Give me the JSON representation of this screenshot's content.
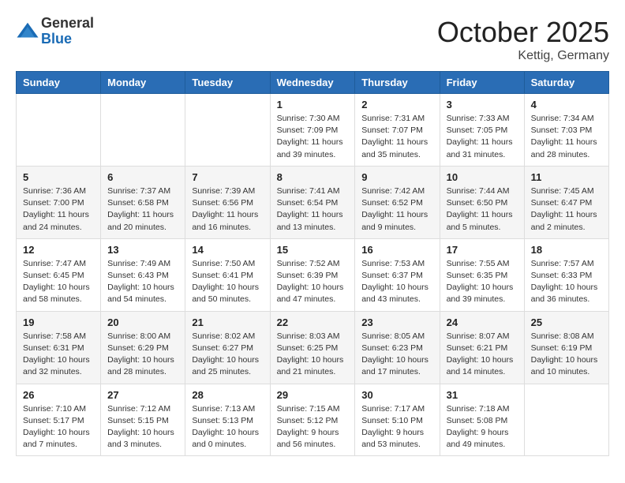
{
  "header": {
    "logo_line1": "General",
    "logo_line2": "Blue",
    "month": "October 2025",
    "location": "Kettig, Germany"
  },
  "weekdays": [
    "Sunday",
    "Monday",
    "Tuesday",
    "Wednesday",
    "Thursday",
    "Friday",
    "Saturday"
  ],
  "weeks": [
    [
      {
        "day": "",
        "info": ""
      },
      {
        "day": "",
        "info": ""
      },
      {
        "day": "",
        "info": ""
      },
      {
        "day": "1",
        "info": "Sunrise: 7:30 AM\nSunset: 7:09 PM\nDaylight: 11 hours\nand 39 minutes."
      },
      {
        "day": "2",
        "info": "Sunrise: 7:31 AM\nSunset: 7:07 PM\nDaylight: 11 hours\nand 35 minutes."
      },
      {
        "day": "3",
        "info": "Sunrise: 7:33 AM\nSunset: 7:05 PM\nDaylight: 11 hours\nand 31 minutes."
      },
      {
        "day": "4",
        "info": "Sunrise: 7:34 AM\nSunset: 7:03 PM\nDaylight: 11 hours\nand 28 minutes."
      }
    ],
    [
      {
        "day": "5",
        "info": "Sunrise: 7:36 AM\nSunset: 7:00 PM\nDaylight: 11 hours\nand 24 minutes."
      },
      {
        "day": "6",
        "info": "Sunrise: 7:37 AM\nSunset: 6:58 PM\nDaylight: 11 hours\nand 20 minutes."
      },
      {
        "day": "7",
        "info": "Sunrise: 7:39 AM\nSunset: 6:56 PM\nDaylight: 11 hours\nand 16 minutes."
      },
      {
        "day": "8",
        "info": "Sunrise: 7:41 AM\nSunset: 6:54 PM\nDaylight: 11 hours\nand 13 minutes."
      },
      {
        "day": "9",
        "info": "Sunrise: 7:42 AM\nSunset: 6:52 PM\nDaylight: 11 hours\nand 9 minutes."
      },
      {
        "day": "10",
        "info": "Sunrise: 7:44 AM\nSunset: 6:50 PM\nDaylight: 11 hours\nand 5 minutes."
      },
      {
        "day": "11",
        "info": "Sunrise: 7:45 AM\nSunset: 6:47 PM\nDaylight: 11 hours\nand 2 minutes."
      }
    ],
    [
      {
        "day": "12",
        "info": "Sunrise: 7:47 AM\nSunset: 6:45 PM\nDaylight: 10 hours\nand 58 minutes."
      },
      {
        "day": "13",
        "info": "Sunrise: 7:49 AM\nSunset: 6:43 PM\nDaylight: 10 hours\nand 54 minutes."
      },
      {
        "day": "14",
        "info": "Sunrise: 7:50 AM\nSunset: 6:41 PM\nDaylight: 10 hours\nand 50 minutes."
      },
      {
        "day": "15",
        "info": "Sunrise: 7:52 AM\nSunset: 6:39 PM\nDaylight: 10 hours\nand 47 minutes."
      },
      {
        "day": "16",
        "info": "Sunrise: 7:53 AM\nSunset: 6:37 PM\nDaylight: 10 hours\nand 43 minutes."
      },
      {
        "day": "17",
        "info": "Sunrise: 7:55 AM\nSunset: 6:35 PM\nDaylight: 10 hours\nand 39 minutes."
      },
      {
        "day": "18",
        "info": "Sunrise: 7:57 AM\nSunset: 6:33 PM\nDaylight: 10 hours\nand 36 minutes."
      }
    ],
    [
      {
        "day": "19",
        "info": "Sunrise: 7:58 AM\nSunset: 6:31 PM\nDaylight: 10 hours\nand 32 minutes."
      },
      {
        "day": "20",
        "info": "Sunrise: 8:00 AM\nSunset: 6:29 PM\nDaylight: 10 hours\nand 28 minutes."
      },
      {
        "day": "21",
        "info": "Sunrise: 8:02 AM\nSunset: 6:27 PM\nDaylight: 10 hours\nand 25 minutes."
      },
      {
        "day": "22",
        "info": "Sunrise: 8:03 AM\nSunset: 6:25 PM\nDaylight: 10 hours\nand 21 minutes."
      },
      {
        "day": "23",
        "info": "Sunrise: 8:05 AM\nSunset: 6:23 PM\nDaylight: 10 hours\nand 17 minutes."
      },
      {
        "day": "24",
        "info": "Sunrise: 8:07 AM\nSunset: 6:21 PM\nDaylight: 10 hours\nand 14 minutes."
      },
      {
        "day": "25",
        "info": "Sunrise: 8:08 AM\nSunset: 6:19 PM\nDaylight: 10 hours\nand 10 minutes."
      }
    ],
    [
      {
        "day": "26",
        "info": "Sunrise: 7:10 AM\nSunset: 5:17 PM\nDaylight: 10 hours\nand 7 minutes."
      },
      {
        "day": "27",
        "info": "Sunrise: 7:12 AM\nSunset: 5:15 PM\nDaylight: 10 hours\nand 3 minutes."
      },
      {
        "day": "28",
        "info": "Sunrise: 7:13 AM\nSunset: 5:13 PM\nDaylight: 10 hours\nand 0 minutes."
      },
      {
        "day": "29",
        "info": "Sunrise: 7:15 AM\nSunset: 5:12 PM\nDaylight: 9 hours\nand 56 minutes."
      },
      {
        "day": "30",
        "info": "Sunrise: 7:17 AM\nSunset: 5:10 PM\nDaylight: 9 hours\nand 53 minutes."
      },
      {
        "day": "31",
        "info": "Sunrise: 7:18 AM\nSunset: 5:08 PM\nDaylight: 9 hours\nand 49 minutes."
      },
      {
        "day": "",
        "info": ""
      }
    ]
  ]
}
